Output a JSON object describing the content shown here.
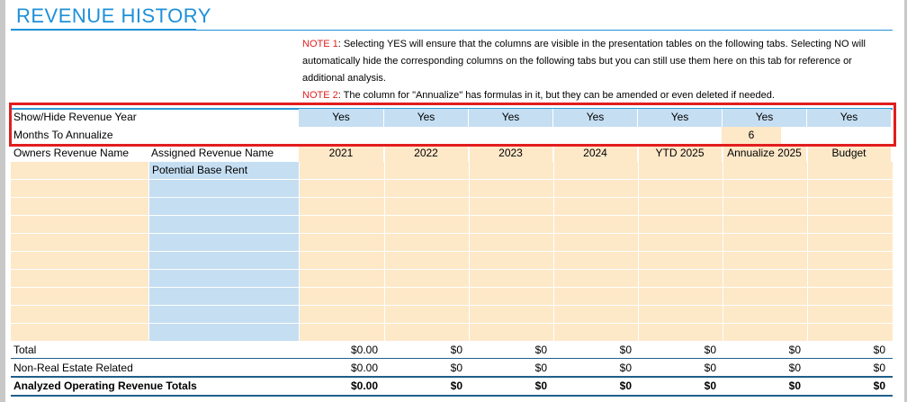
{
  "page": {
    "title": "REVENUE HISTORY"
  },
  "notes": {
    "note1_tag": "NOTE 1",
    "note1_text": ": Selecting YES will ensure that the columns are visible in the presentation tables on the following tabs. Selecting NO will automatically hide the corresponding columns on the following tabs but you can still use them here on this tab for reference or additional analysis.",
    "note2_tag": "NOTE 2",
    "note2_text": ": The column for \"Annualize\" has formulas in it, but they can be amended or even deleted if needed."
  },
  "show_hide": {
    "label": "Show/Hide Revenue Year",
    "values": [
      "Yes",
      "Yes",
      "Yes",
      "Yes",
      "Yes",
      "Yes",
      "Yes"
    ]
  },
  "annualize": {
    "label": "Months To Annualize",
    "months": "6"
  },
  "header": {
    "owners_label": "Owners Revenue Name",
    "assigned_label": "Assigned Revenue Name",
    "columns": [
      "2021",
      "2022",
      "2023",
      "2024",
      "YTD 2025",
      "Annualize 2025",
      "Budget"
    ]
  },
  "rows": {
    "assigned_first": "Potential Base Rent"
  },
  "totals": {
    "total": {
      "label": "Total",
      "values": [
        "$0.00",
        "$0",
        "$0",
        "$0",
        "$0",
        "$0",
        "$0"
      ]
    },
    "non_re": {
      "label": "Non-Real Estate Related",
      "values": [
        "$0.00",
        "$0",
        "$0",
        "$0",
        "$0",
        "$0",
        "$0"
      ]
    },
    "analyzed": {
      "label": "Analyzed Operating Revenue Totals",
      "values": [
        "$0.00",
        "$0",
        "$0",
        "$0",
        "$0",
        "$0",
        "$0"
      ]
    }
  },
  "colors": {
    "title_blue": "#1e90d8",
    "note_red": "#e0201e",
    "input_blue": "#c5def2",
    "input_peach": "#fde8c8",
    "highlight_red": "#e21d1d"
  }
}
